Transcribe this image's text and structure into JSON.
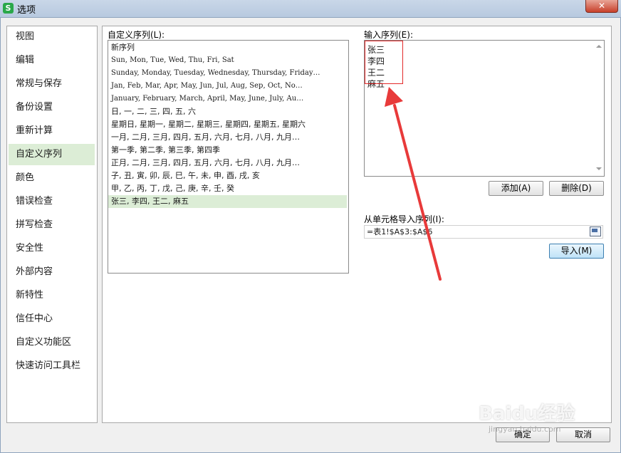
{
  "window": {
    "title": "选项",
    "app_icon_label": "S",
    "close_label": "✕"
  },
  "nav": {
    "items": [
      "视图",
      "编辑",
      "常规与保存",
      "备份设置",
      "重新计算",
      "自定义序列",
      "颜色",
      "错误检查",
      "拼写检查",
      "安全性",
      "外部内容",
      "新特性",
      "信任中心",
      "自定义功能区",
      "快速访问工具栏"
    ],
    "selected_index": 5
  },
  "custom_lists": {
    "label": "自定义序列(L):",
    "items": [
      "新序列",
      "Sun, Mon, Tue, Wed, Thu, Fri, Sat",
      "Sunday, Monday, Tuesday, Wednesday, Thursday, Friday…",
      "Jan, Feb, Mar, Apr, May, Jun, Jul, Aug, Sep, Oct, No…",
      "January, February, March, April, May, June, July, Au…",
      "日, 一, 二, 三, 四, 五, 六",
      "星期日, 星期一, 星期二, 星期三, 星期四, 星期五, 星期六",
      "一月, 二月, 三月, 四月, 五月, 六月, 七月, 八月, 九月…",
      "第一季, 第二季, 第三季, 第四季",
      "正月, 二月, 三月, 四月, 五月, 六月, 七月, 八月, 九月…",
      "子, 丑, 寅, 卯, 辰, 巳, 午, 未, 申, 酉, 戌, 亥",
      "甲, 乙, 丙, 丁, 戊, 己, 庚, 辛, 壬, 癸",
      "张三, 李四, 王二, 麻五"
    ],
    "selected_index": 12
  },
  "entries": {
    "label": "输入序列(E):",
    "value": "张三\n李四\n王二\n麻五"
  },
  "buttons": {
    "add": "添加(A)",
    "delete": "删除(D)",
    "import": "导入(M)",
    "ok": "确定",
    "cancel": "取消"
  },
  "import_from_cells": {
    "label": "从单元格导入序列(I):",
    "value": "=表1!$A$3:$A$6"
  },
  "watermark": {
    "text": "Baidu经验",
    "sub": "jingyan.baidu.com"
  },
  "annotation": {
    "color": "#e32a2a"
  }
}
